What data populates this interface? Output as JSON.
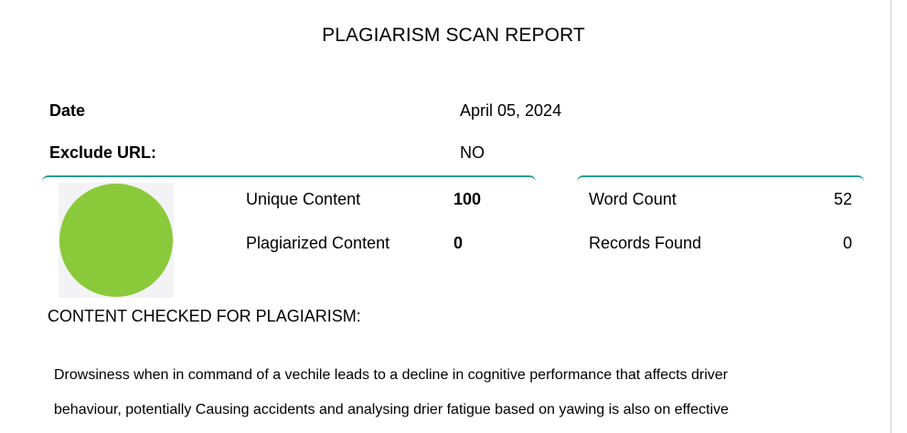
{
  "report": {
    "title": "PLAGIARISM SCAN REPORT"
  },
  "meta": {
    "date_label": "Date",
    "date_value": "April 05, 2024",
    "exclude_url_label": "Exclude URL:",
    "exclude_url_value": "NO"
  },
  "stats": {
    "unique_label": "Unique Content",
    "unique_value": "100",
    "plagiarized_label": "Plagiarized Content",
    "plagiarized_value": "0",
    "word_count_label": "Word Count",
    "word_count_value": "52",
    "records_label": "Records Found",
    "records_value": "0"
  },
  "chart_data": {
    "type": "pie",
    "categories": [
      "Unique Content",
      "Plagiarized Content"
    ],
    "values": [
      100,
      0
    ],
    "colors": [
      "#8ac93a",
      "#e53935"
    ]
  },
  "content": {
    "section_title": "CONTENT CHECKED FOR PLAGIARISM:",
    "line1": "Drowsiness when in command of a vechile leads to a decline in cognitive performance that affects driver",
    "line2": "behaviour, potentially Causing accidents and analysing drier fatigue based on yawing is also on effective"
  },
  "colors": {
    "accent": "#2a9d94",
    "unique": "#8ac93a"
  }
}
